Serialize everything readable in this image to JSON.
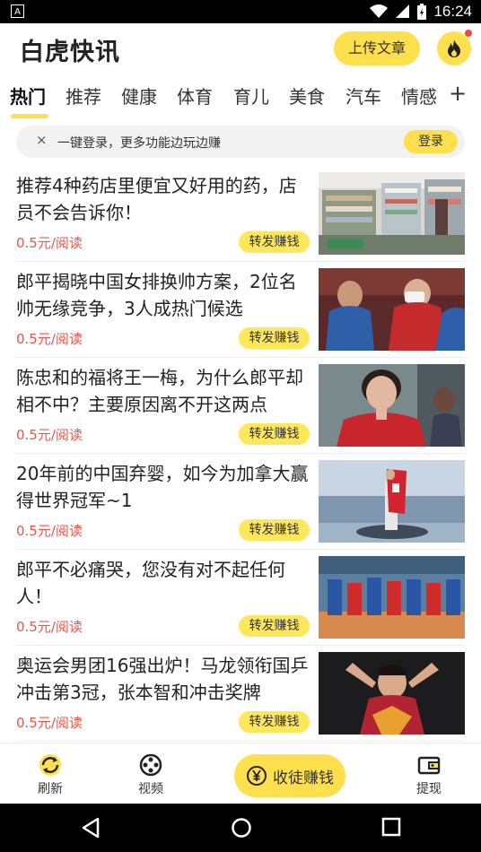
{
  "status_bar": {
    "time": "16:24",
    "left_icon": "notification-a-icon",
    "icons": [
      "wifi-icon",
      "signal-icon",
      "battery-charging-icon"
    ]
  },
  "header": {
    "title": "白虎快讯",
    "upload_label": "上传文章",
    "fire_icon": "fire-icon"
  },
  "tabs": {
    "items": [
      "热门",
      "推荐",
      "健康",
      "体育",
      "育儿",
      "美食",
      "汽车",
      "情感"
    ],
    "active": "热门",
    "more": "+"
  },
  "login_bar": {
    "close": "×",
    "text": "一键登录，更多功能边玩边赚",
    "button": "登录"
  },
  "news": [
    {
      "title": "推荐4种药店里便宜又好用的药，店员不会告诉你！",
      "reward": "0.5元/阅读",
      "share": "转发赚钱",
      "image": "pharmacy-shelves-photo"
    },
    {
      "title": "郎平揭晓中国女排换帅方案，2位名帅无缘竞争，3人成热门候选",
      "reward": "0.5元/阅读",
      "share": "转发赚钱",
      "image": "volleyball-players-hugging-photo"
    },
    {
      "title": "陈忠和的福将王一梅，为什么郎平却相不中？主要原因离不开这两点",
      "reward": "0.5元/阅读",
      "share": "转发赚钱",
      "image": "smiling-player-photo"
    },
    {
      "title": "20年前的中国弃婴，如今为加拿大赢得世界冠军~1",
      "reward": "0.5元/阅读",
      "share": "转发赚钱",
      "image": "podium-canada-flag-photo"
    },
    {
      "title": "郎平不必痛哭，您没有对不起任何人！",
      "reward": "0.5元/阅读",
      "share": "转发赚钱",
      "image": "volleyball-team-court-photo"
    },
    {
      "title": "奥运会男团16强出炉！马龙领衔国乒冲击第3冠，张本智和冲击奖牌",
      "reward": "0.5元/阅读",
      "share": "转发赚钱",
      "image": "table-tennis-player-photo"
    }
  ],
  "bottom_nav": {
    "refresh": "刷新",
    "video": "视频",
    "recruit": "收徒赚钱",
    "withdraw": "提现"
  },
  "colors": {
    "accent": "#FEDF4E",
    "reward_red": "#E5584B",
    "badge_red": "#F04A3A"
  }
}
